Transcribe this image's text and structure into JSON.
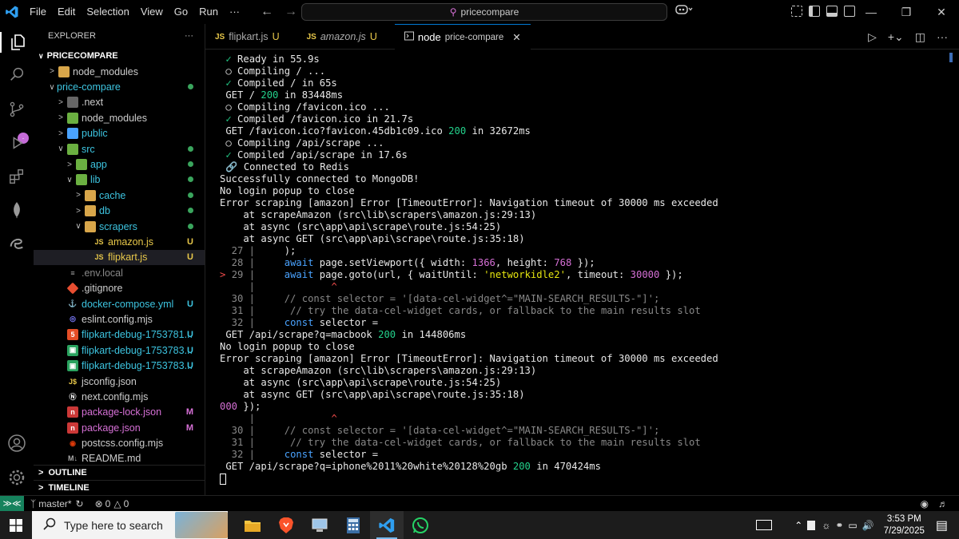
{
  "titlebar": {
    "menu": [
      "File",
      "Edit",
      "Selection",
      "View",
      "Go",
      "Run",
      "···"
    ],
    "search_text": "pricecompare"
  },
  "sidebar": {
    "title": "EXPLORER",
    "root": "PRICECOMPARE",
    "items": [
      {
        "label": "node_modules",
        "indent": 1,
        "chev": ">",
        "icon": "folder",
        "status": ""
      },
      {
        "label": "price-compare",
        "indent": 1,
        "chev": "v",
        "icon": "",
        "status": "dot",
        "color": "#3dc4e0"
      },
      {
        "label": ".next",
        "indent": 2,
        "chev": ">",
        "icon": "folder-next",
        "status": ""
      },
      {
        "label": "node_modules",
        "indent": 2,
        "chev": ">",
        "icon": "folder-node",
        "status": ""
      },
      {
        "label": "public",
        "indent": 2,
        "chev": ">",
        "icon": "folder-public",
        "status": "",
        "color": "#3dc4e0"
      },
      {
        "label": "src",
        "indent": 2,
        "chev": "v",
        "icon": "folder-src",
        "status": "dot",
        "color": "#3dc4e0"
      },
      {
        "label": "app",
        "indent": 3,
        "chev": ">",
        "icon": "folder-app",
        "status": "dot",
        "color": "#3dc4e0"
      },
      {
        "label": "lib",
        "indent": 3,
        "chev": "v",
        "icon": "folder-lib",
        "status": "dot",
        "color": "#3dc4e0"
      },
      {
        "label": "cache",
        "indent": 4,
        "chev": ">",
        "icon": "folder",
        "status": "dot",
        "color": "#3dc4e0"
      },
      {
        "label": "db",
        "indent": 4,
        "chev": ">",
        "icon": "folder",
        "status": "dot",
        "color": "#3dc4e0"
      },
      {
        "label": "scrapers",
        "indent": 4,
        "chev": "v",
        "icon": "folder",
        "status": "dot",
        "color": "#3dc4e0"
      },
      {
        "label": "amazon.js",
        "indent": 5,
        "chev": "",
        "icon": "js",
        "status": "U",
        "color": "#e8c84a"
      },
      {
        "label": "flipkart.js",
        "indent": 5,
        "chev": "",
        "icon": "js",
        "status": "U",
        "color": "#e8c84a",
        "selected": true
      },
      {
        "label": ".env.local",
        "indent": 2,
        "chev": "",
        "icon": "env",
        "status": "",
        "color": "#888"
      },
      {
        "label": ".gitignore",
        "indent": 2,
        "chev": "",
        "icon": "git",
        "status": "",
        "color": "#ccc"
      },
      {
        "label": "docker-compose.yml",
        "indent": 2,
        "chev": "",
        "icon": "docker",
        "status": "U",
        "color": "#3dc4e0"
      },
      {
        "label": "eslint.config.mjs",
        "indent": 2,
        "chev": "",
        "icon": "eslint",
        "status": "",
        "color": "#ccc"
      },
      {
        "label": "flipkart-debug-1753781...",
        "indent": 2,
        "chev": "",
        "icon": "html",
        "status": "U",
        "color": "#3dc4e0"
      },
      {
        "label": "flipkart-debug-1753783...",
        "indent": 2,
        "chev": "",
        "icon": "img",
        "status": "U",
        "color": "#3dc4e0"
      },
      {
        "label": "flipkart-debug-1753783...",
        "indent": 2,
        "chev": "",
        "icon": "img",
        "status": "U",
        "color": "#3dc4e0"
      },
      {
        "label": "jsconfig.json",
        "indent": 2,
        "chev": "",
        "icon": "jsjson",
        "status": "",
        "color": "#ccc"
      },
      {
        "label": "next.config.mjs",
        "indent": 2,
        "chev": "",
        "icon": "next",
        "status": "",
        "color": "#ccc"
      },
      {
        "label": "package-lock.json",
        "indent": 2,
        "chev": "",
        "icon": "npm",
        "status": "M",
        "color": "#d670d6"
      },
      {
        "label": "package.json",
        "indent": 2,
        "chev": "",
        "icon": "npm",
        "status": "M",
        "color": "#d670d6"
      },
      {
        "label": "postcss.config.mjs",
        "indent": 2,
        "chev": "",
        "icon": "postcss",
        "status": "",
        "color": "#ccc"
      },
      {
        "label": "README.md",
        "indent": 2,
        "chev": "",
        "icon": "md",
        "status": "",
        "color": "#ccc"
      }
    ],
    "outline": "OUTLINE",
    "timeline": "TIMELINE"
  },
  "tabs": [
    {
      "icon": "JS",
      "label": "flipkart.js",
      "status": "U",
      "italic": false
    },
    {
      "icon": "JS",
      "label": "amazon.js",
      "status": "U",
      "italic": true
    },
    {
      "icon": "term",
      "label": "node",
      "sub": "price-compare",
      "active": true
    }
  ],
  "terminal": {
    "lines": [
      [
        {
          "t": " ",
          "c": ""
        },
        {
          "t": "✓ ",
          "c": "g"
        },
        {
          "t": "Ready in 55.9s",
          "c": ""
        }
      ],
      [
        {
          "t": " ○ Compiling / ...",
          "c": ""
        }
      ],
      [
        {
          "t": " ",
          "c": ""
        },
        {
          "t": "✓ ",
          "c": "g"
        },
        {
          "t": "Compiled / in 65s",
          "c": ""
        }
      ],
      [
        {
          "t": " GET / ",
          "c": ""
        },
        {
          "t": "200",
          "c": "grn"
        },
        {
          "t": " in 83448ms",
          "c": ""
        }
      ],
      [
        {
          "t": " ○ Compiling /favicon.ico ...",
          "c": ""
        }
      ],
      [
        {
          "t": " ",
          "c": ""
        },
        {
          "t": "✓ ",
          "c": "g"
        },
        {
          "t": "Compiled /favicon.ico in 21.7s",
          "c": ""
        }
      ],
      [
        {
          "t": " GET /favicon.ico?favicon.45db1c09.ico ",
          "c": ""
        },
        {
          "t": "200",
          "c": "grn"
        },
        {
          "t": " in 32672ms",
          "c": ""
        }
      ],
      [
        {
          "t": " ○ Compiling /api/scrape ...",
          "c": ""
        }
      ],
      [
        {
          "t": " ",
          "c": ""
        },
        {
          "t": "✓ ",
          "c": "g"
        },
        {
          "t": "Compiled /api/scrape in 17.6s",
          "c": ""
        }
      ],
      [
        {
          "t": " 🔗 Connected to Redis",
          "c": ""
        }
      ],
      [
        {
          "t": "Successfully connected to MongoDB!",
          "c": ""
        }
      ],
      [
        {
          "t": "No login popup to close",
          "c": ""
        }
      ],
      [
        {
          "t": "Error scraping [amazon] Error [TimeoutError]: Navigation timeout of 30000 ms exceeded",
          "c": ""
        }
      ],
      [
        {
          "t": "    at scrapeAmazon (src\\lib\\scrapers\\amazon.js:29:13)",
          "c": ""
        }
      ],
      [
        {
          "t": "    at async (src\\app\\api\\scrape\\route.js:54:25)",
          "c": ""
        }
      ],
      [
        {
          "t": "    at async GET (src\\app\\api\\scrape\\route.js:35:18)",
          "c": ""
        }
      ],
      [
        {
          "t": "  27 | ",
          "c": "ln"
        },
        {
          "t": "    );",
          "c": ""
        }
      ],
      [
        {
          "t": "  28 | ",
          "c": "ln"
        },
        {
          "t": "    ",
          "c": ""
        },
        {
          "t": "await",
          "c": "kw"
        },
        {
          "t": " page.setViewport({ width: ",
          "c": ""
        },
        {
          "t": "1366",
          "c": "mag"
        },
        {
          "t": ", height: ",
          "c": ""
        },
        {
          "t": "768",
          "c": "mag"
        },
        {
          "t": " });",
          "c": ""
        }
      ],
      [
        {
          "t": "> ",
          "c": "red"
        },
        {
          "t": "29 | ",
          "c": "ln"
        },
        {
          "t": "    ",
          "c": ""
        },
        {
          "t": "await",
          "c": "kw"
        },
        {
          "t": " page.goto(url, { waitUntil: ",
          "c": ""
        },
        {
          "t": "'networkidle2'",
          "c": "str"
        },
        {
          "t": ", timeout: ",
          "c": ""
        },
        {
          "t": "30000",
          "c": "mag"
        },
        {
          "t": " });",
          "c": ""
        }
      ],
      [
        {
          "t": "     | ",
          "c": "ln"
        },
        {
          "t": "            ",
          "c": ""
        },
        {
          "t": "^",
          "c": "red"
        }
      ],
      [
        {
          "t": "  30 | ",
          "c": "ln"
        },
        {
          "t": "    // const selector = '[data-cel-widget^=\"MAIN-SEARCH_RESULTS-\"]';",
          "c": "cm"
        }
      ],
      [
        {
          "t": "  31 | ",
          "c": "ln"
        },
        {
          "t": "     // try the data-cel-widget cards, or fallback to the main results slot",
          "c": "cm"
        }
      ],
      [
        {
          "t": "  32 | ",
          "c": "ln"
        },
        {
          "t": "    ",
          "c": ""
        },
        {
          "t": "const",
          "c": "kw"
        },
        {
          "t": " selector =",
          "c": ""
        }
      ],
      [
        {
          "t": " GET /api/scrape?q=macbook ",
          "c": ""
        },
        {
          "t": "200",
          "c": "grn"
        },
        {
          "t": " in 144806ms",
          "c": ""
        }
      ],
      [
        {
          "t": "No login popup to close",
          "c": ""
        }
      ],
      [
        {
          "t": "Error scraping [amazon] Error [TimeoutError]: Navigation timeout of 30000 ms exceeded",
          "c": ""
        }
      ],
      [
        {
          "t": "    at scrapeAmazon (src\\lib\\scrapers\\amazon.js:29:13)",
          "c": ""
        }
      ],
      [
        {
          "t": "    at async (src\\app\\api\\scrape\\route.js:54:25)",
          "c": ""
        }
      ],
      [
        {
          "t": "    at async GET (src\\app\\api\\scrape\\route.js:35:18)",
          "c": ""
        }
      ],
      [
        {
          "t": "000",
          "c": "mag"
        },
        {
          "t": " });",
          "c": ""
        }
      ],
      [
        {
          "t": "     | ",
          "c": "ln"
        },
        {
          "t": "            ",
          "c": ""
        },
        {
          "t": "^",
          "c": "red"
        }
      ],
      [
        {
          "t": "  30 | ",
          "c": "ln"
        },
        {
          "t": "    // const selector = '[data-cel-widget^=\"MAIN-SEARCH_RESULTS-\"]';",
          "c": "cm"
        }
      ],
      [
        {
          "t": "  31 | ",
          "c": "ln"
        },
        {
          "t": "     // try the data-cel-widget cards, or fallback to the main results slot",
          "c": "cm"
        }
      ],
      [
        {
          "t": "  32 | ",
          "c": "ln"
        },
        {
          "t": "    ",
          "c": ""
        },
        {
          "t": "const",
          "c": "kw"
        },
        {
          "t": " selector =",
          "c": ""
        }
      ],
      [
        {
          "t": " GET /api/scrape?q=iphone%2011%20white%20128%20gb ",
          "c": ""
        },
        {
          "t": "200",
          "c": "grn"
        },
        {
          "t": " in 470424ms",
          "c": ""
        }
      ]
    ]
  },
  "statusbar": {
    "branch": "master*",
    "errors": "0",
    "warnings": "0"
  },
  "taskbar": {
    "search_placeholder": "Type here to search",
    "time": "3:53 PM",
    "date": "7/29/2025"
  }
}
